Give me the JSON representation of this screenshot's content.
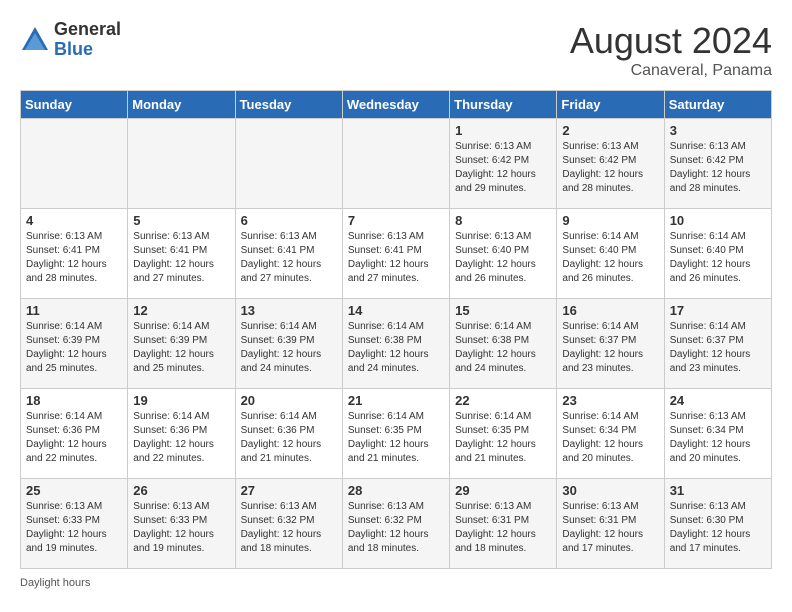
{
  "header": {
    "logo_general": "General",
    "logo_blue": "Blue",
    "month_year": "August 2024",
    "location": "Canaveral, Panama"
  },
  "footer": {
    "daylight_label": "Daylight hours"
  },
  "calendar": {
    "days_of_week": [
      "Sunday",
      "Monday",
      "Tuesday",
      "Wednesday",
      "Thursday",
      "Friday",
      "Saturday"
    ],
    "weeks": [
      [
        {
          "day": "",
          "info": ""
        },
        {
          "day": "",
          "info": ""
        },
        {
          "day": "",
          "info": ""
        },
        {
          "day": "",
          "info": ""
        },
        {
          "day": "1",
          "info": "Sunrise: 6:13 AM\nSunset: 6:42 PM\nDaylight: 12 hours\nand 29 minutes."
        },
        {
          "day": "2",
          "info": "Sunrise: 6:13 AM\nSunset: 6:42 PM\nDaylight: 12 hours\nand 28 minutes."
        },
        {
          "day": "3",
          "info": "Sunrise: 6:13 AM\nSunset: 6:42 PM\nDaylight: 12 hours\nand 28 minutes."
        }
      ],
      [
        {
          "day": "4",
          "info": "Sunrise: 6:13 AM\nSunset: 6:41 PM\nDaylight: 12 hours\nand 28 minutes."
        },
        {
          "day": "5",
          "info": "Sunrise: 6:13 AM\nSunset: 6:41 PM\nDaylight: 12 hours\nand 27 minutes."
        },
        {
          "day": "6",
          "info": "Sunrise: 6:13 AM\nSunset: 6:41 PM\nDaylight: 12 hours\nand 27 minutes."
        },
        {
          "day": "7",
          "info": "Sunrise: 6:13 AM\nSunset: 6:41 PM\nDaylight: 12 hours\nand 27 minutes."
        },
        {
          "day": "8",
          "info": "Sunrise: 6:13 AM\nSunset: 6:40 PM\nDaylight: 12 hours\nand 26 minutes."
        },
        {
          "day": "9",
          "info": "Sunrise: 6:14 AM\nSunset: 6:40 PM\nDaylight: 12 hours\nand 26 minutes."
        },
        {
          "day": "10",
          "info": "Sunrise: 6:14 AM\nSunset: 6:40 PM\nDaylight: 12 hours\nand 26 minutes."
        }
      ],
      [
        {
          "day": "11",
          "info": "Sunrise: 6:14 AM\nSunset: 6:39 PM\nDaylight: 12 hours\nand 25 minutes."
        },
        {
          "day": "12",
          "info": "Sunrise: 6:14 AM\nSunset: 6:39 PM\nDaylight: 12 hours\nand 25 minutes."
        },
        {
          "day": "13",
          "info": "Sunrise: 6:14 AM\nSunset: 6:39 PM\nDaylight: 12 hours\nand 24 minutes."
        },
        {
          "day": "14",
          "info": "Sunrise: 6:14 AM\nSunset: 6:38 PM\nDaylight: 12 hours\nand 24 minutes."
        },
        {
          "day": "15",
          "info": "Sunrise: 6:14 AM\nSunset: 6:38 PM\nDaylight: 12 hours\nand 24 minutes."
        },
        {
          "day": "16",
          "info": "Sunrise: 6:14 AM\nSunset: 6:37 PM\nDaylight: 12 hours\nand 23 minutes."
        },
        {
          "day": "17",
          "info": "Sunrise: 6:14 AM\nSunset: 6:37 PM\nDaylight: 12 hours\nand 23 minutes."
        }
      ],
      [
        {
          "day": "18",
          "info": "Sunrise: 6:14 AM\nSunset: 6:36 PM\nDaylight: 12 hours\nand 22 minutes."
        },
        {
          "day": "19",
          "info": "Sunrise: 6:14 AM\nSunset: 6:36 PM\nDaylight: 12 hours\nand 22 minutes."
        },
        {
          "day": "20",
          "info": "Sunrise: 6:14 AM\nSunset: 6:36 PM\nDaylight: 12 hours\nand 21 minutes."
        },
        {
          "day": "21",
          "info": "Sunrise: 6:14 AM\nSunset: 6:35 PM\nDaylight: 12 hours\nand 21 minutes."
        },
        {
          "day": "22",
          "info": "Sunrise: 6:14 AM\nSunset: 6:35 PM\nDaylight: 12 hours\nand 21 minutes."
        },
        {
          "day": "23",
          "info": "Sunrise: 6:14 AM\nSunset: 6:34 PM\nDaylight: 12 hours\nand 20 minutes."
        },
        {
          "day": "24",
          "info": "Sunrise: 6:13 AM\nSunset: 6:34 PM\nDaylight: 12 hours\nand 20 minutes."
        }
      ],
      [
        {
          "day": "25",
          "info": "Sunrise: 6:13 AM\nSunset: 6:33 PM\nDaylight: 12 hours\nand 19 minutes."
        },
        {
          "day": "26",
          "info": "Sunrise: 6:13 AM\nSunset: 6:33 PM\nDaylight: 12 hours\nand 19 minutes."
        },
        {
          "day": "27",
          "info": "Sunrise: 6:13 AM\nSunset: 6:32 PM\nDaylight: 12 hours\nand 18 minutes."
        },
        {
          "day": "28",
          "info": "Sunrise: 6:13 AM\nSunset: 6:32 PM\nDaylight: 12 hours\nand 18 minutes."
        },
        {
          "day": "29",
          "info": "Sunrise: 6:13 AM\nSunset: 6:31 PM\nDaylight: 12 hours\nand 18 minutes."
        },
        {
          "day": "30",
          "info": "Sunrise: 6:13 AM\nSunset: 6:31 PM\nDaylight: 12 hours\nand 17 minutes."
        },
        {
          "day": "31",
          "info": "Sunrise: 6:13 AM\nSunset: 6:30 PM\nDaylight: 12 hours\nand 17 minutes."
        }
      ]
    ]
  }
}
